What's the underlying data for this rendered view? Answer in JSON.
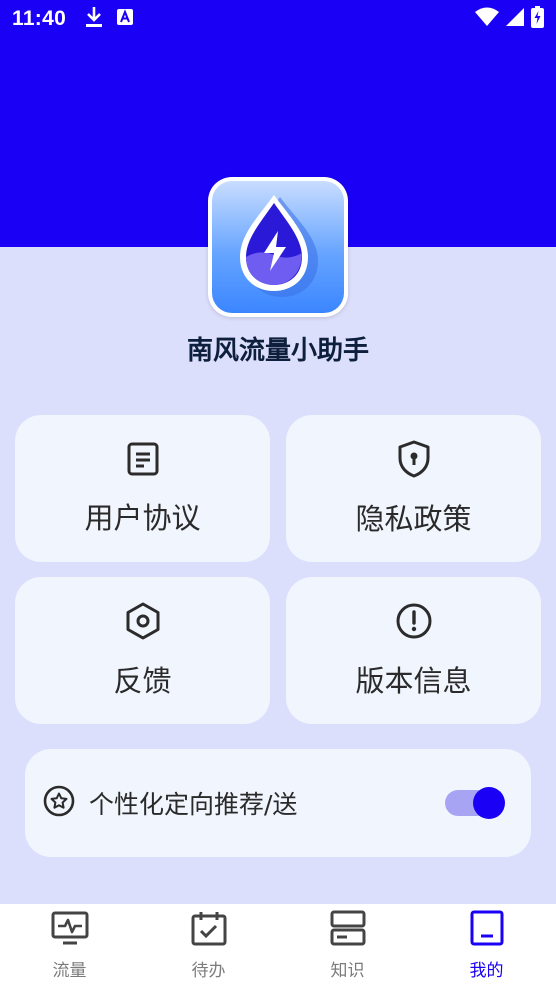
{
  "status_bar": {
    "time": "11:40",
    "left_icons": [
      "download-icon",
      "a-box-icon"
    ],
    "right_icons": [
      "wifi-icon",
      "signal-icon",
      "battery-icon"
    ]
  },
  "app": {
    "name": "南风流量小助手",
    "icon": "water-drop-lightning-icon"
  },
  "cards": [
    {
      "label": "用户协议",
      "icon": "document-icon"
    },
    {
      "label": "隐私政策",
      "icon": "shield-lock-icon"
    },
    {
      "label": "反馈",
      "icon": "hexagon-nut-icon"
    },
    {
      "label": "版本信息",
      "icon": "exclamation-circle-icon"
    }
  ],
  "personalization": {
    "label": "个性化定向推荐/送",
    "icon": "star-circle-icon",
    "enabled": true
  },
  "bottom_nav": {
    "items": [
      {
        "label": "流量",
        "icon": "monitor-pulse-icon",
        "active": false
      },
      {
        "label": "待办",
        "icon": "calendar-check-icon",
        "active": false
      },
      {
        "label": "知识",
        "icon": "server-icon",
        "active": false
      },
      {
        "label": "我的",
        "icon": "tablet-icon",
        "active": true
      }
    ]
  },
  "colors": {
    "accent": "#1a00f5",
    "page_bg": "#dcdffc",
    "card_bg": "#f1f5fe",
    "nav_inactive": "#7b7b7b"
  }
}
